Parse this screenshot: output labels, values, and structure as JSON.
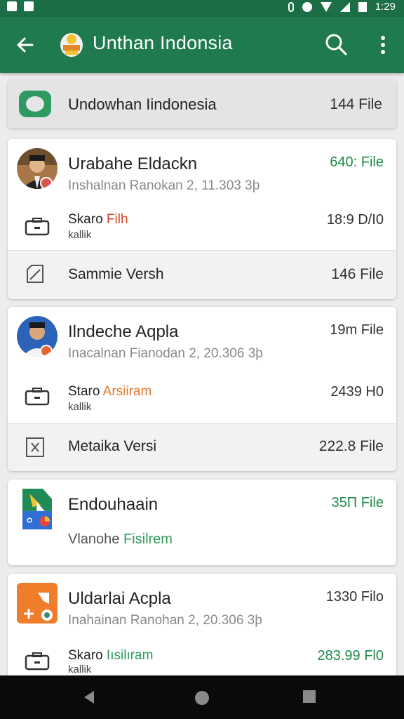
{
  "status_bar": {
    "time": "1:29"
  },
  "app_bar": {
    "title": "Unthan Indonsia"
  },
  "summary": {
    "label": "Undowhan Iindonesia",
    "count": "144 File"
  },
  "cards": [
    {
      "name": "Urabahe Eldackn",
      "subtitle": "Inshalnan Ranokan  2, 11.303 3þ",
      "count": "640: File",
      "row": {
        "title_a": "Skaro ",
        "title_b": "Filh",
        "sub": "kallik",
        "size": "18:9 D/I0"
      },
      "gray": {
        "label": "Sammie Versh",
        "count": "146 File"
      }
    },
    {
      "name": "Ilndeche Aqpla",
      "subtitle": "Inacalnan Fianodan  2, 20.306 3þ",
      "count": "19m File",
      "row": {
        "title_a": "Staro ",
        "title_b": "Arsiiram",
        "sub": "kallik",
        "size": "2439 H0"
      },
      "gray": {
        "label": "Metaika Versi",
        "count": "222.8 File"
      }
    },
    {
      "name": "Endouhaain",
      "subtitle_a": "Vlanohe ",
      "subtitle_b": "Fisilrem",
      "count": "35Π File"
    },
    {
      "name": "Uldarlai Acpla",
      "subtitle": "Inahainan Ranohan  2, 20.306 3þ",
      "count": "1330 Filo",
      "row": {
        "title_a": "Skaro ",
        "title_b": "Iısilıram",
        "sub": "kallik",
        "size": "283.99 Fl0"
      }
    }
  ],
  "colors": {
    "primary": "#1f7a4d",
    "status": "#1b6e45",
    "accent_green": "#1f8a4c",
    "accent_red": "#d2452a",
    "accent_orange": "#e07a2e"
  }
}
